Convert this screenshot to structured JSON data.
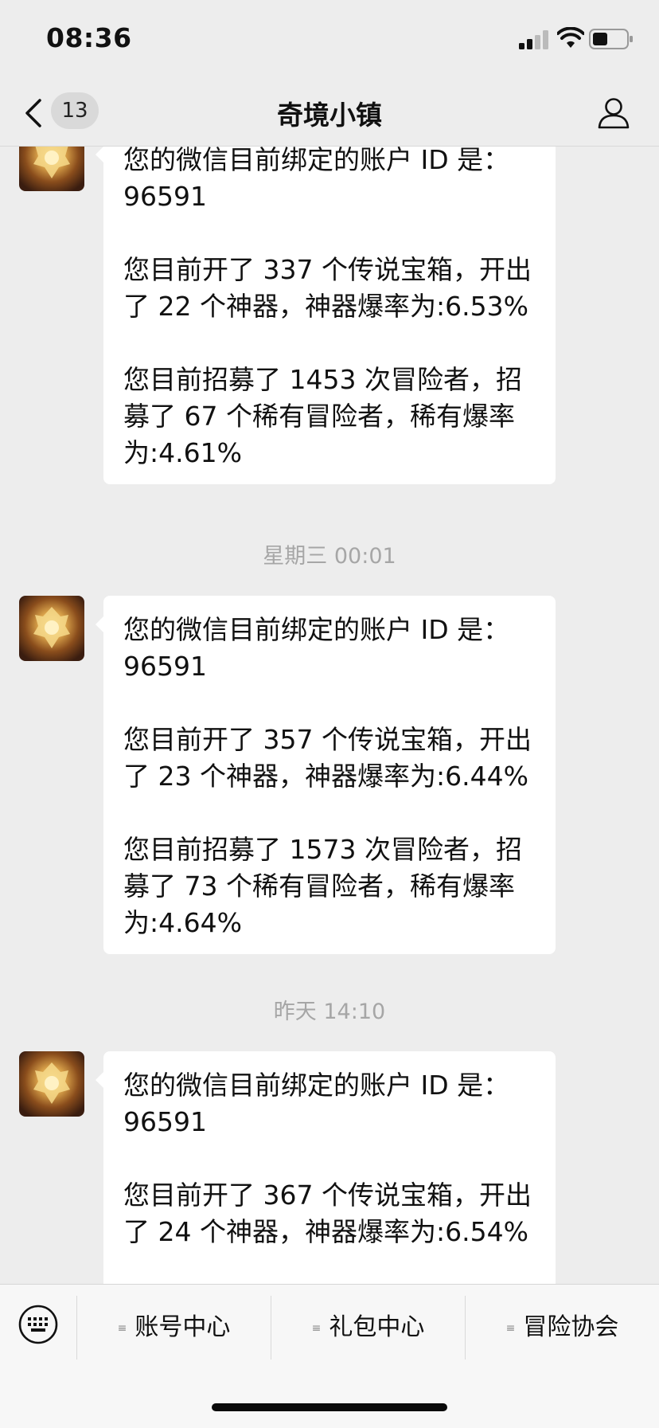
{
  "status_bar": {
    "time": "08:36"
  },
  "nav": {
    "badge": "13",
    "title": "奇境小镇"
  },
  "messages": [
    {
      "lines1": [
        "您的微信目前绑定的账户 ID 是：",
        "96591"
      ],
      "lines2": [
        "您目前开了 337 个传说宝箱，开出",
        "了 22 个神器，神器爆率为:6.53%"
      ],
      "lines3": [
        "您目前招募了 1453 次冒险者，招",
        "募了 67 个稀有冒险者，稀有爆率",
        "为:4.61%"
      ]
    },
    {
      "timestamp": "星期三 00:01",
      "lines1": [
        "您的微信目前绑定的账户 ID 是：",
        "96591"
      ],
      "lines2": [
        "您目前开了 357 个传说宝箱，开出",
        "了 23 个神器，神器爆率为:6.44%"
      ],
      "lines3": [
        "您目前招募了 1573 次冒险者，招",
        "募了 73 个稀有冒险者，稀有爆率",
        "为:4.64%"
      ]
    },
    {
      "timestamp": "昨天 14:10",
      "lines1": [
        "您的微信目前绑定的账户 ID 是：",
        "96591"
      ],
      "lines2": [
        "您目前开了 367 个传说宝箱，开出",
        "了 24 个神器，神器爆率为:6.54%"
      ]
    }
  ],
  "bottom_menu": {
    "items": [
      "账号中心",
      "礼包中心",
      "冒险协会"
    ]
  },
  "icons": {
    "back": "chevron-left-icon",
    "profile": "person-icon",
    "keyboard": "keyboard-icon",
    "menu_lines": "menu-lines-icon"
  },
  "colors": {
    "background": "#ededed",
    "bubble": "#ffffff",
    "timestamp": "#a6a6a6"
  }
}
